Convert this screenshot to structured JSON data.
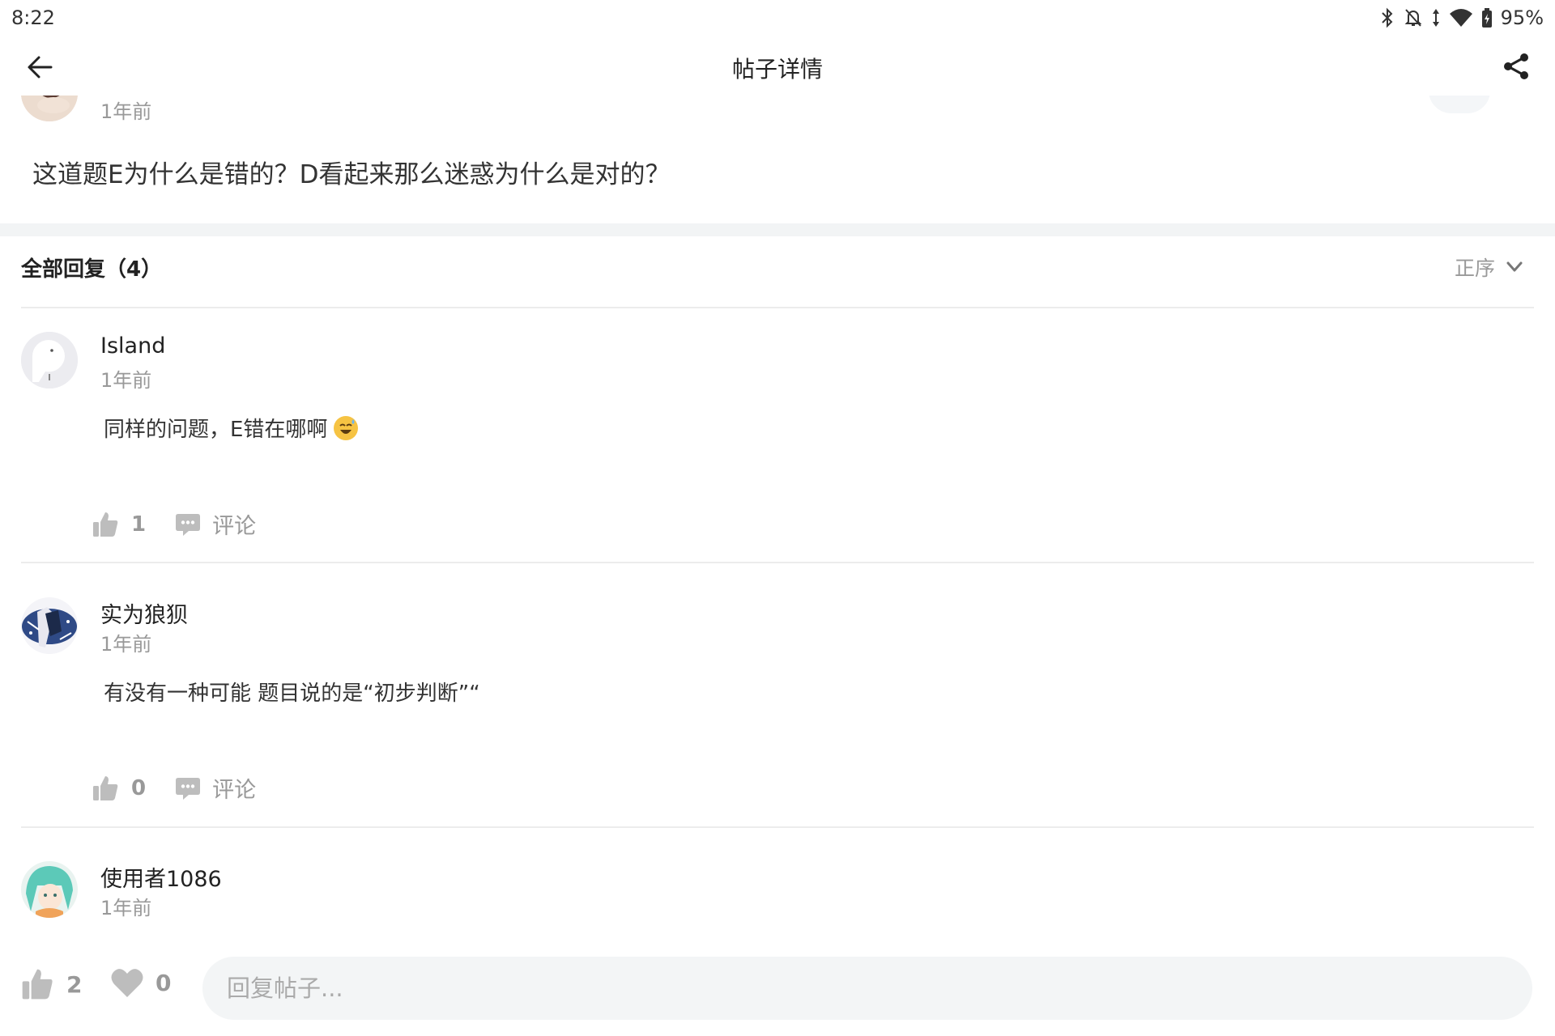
{
  "status_bar": {
    "time": "8:22",
    "battery": "95%",
    "icons": [
      "bluetooth-icon",
      "bell-off-icon",
      "data-arrows-icon",
      "wifi-icon",
      "battery-icon"
    ]
  },
  "app_bar": {
    "title": "帖子详情",
    "back_icon": "arrow-left-icon",
    "share_icon": "share-icon"
  },
  "post": {
    "time": "1年前",
    "body": "这道题E为什么是错的？D看起来那么迷惑为什么是对的？"
  },
  "replies_header": {
    "title": "全部回复（4）",
    "sort_label": "正序"
  },
  "replies": [
    {
      "name": "Island",
      "time": "1年前",
      "body": "同样的问题，E错在哪啊",
      "emoji": "sweat-smile-emoji",
      "likes": "1",
      "comment_label": "评论"
    },
    {
      "name": "实为狼狈",
      "time": "1年前",
      "body": "有没有一种可能  题目说的是“初步判断”“",
      "likes": "0",
      "comment_label": "评论"
    },
    {
      "name": "使用者1086",
      "time": "1年前"
    }
  ],
  "bottom_bar": {
    "like_count": "2",
    "favorite_count": "0",
    "reply_placeholder": "回复帖子..."
  },
  "colors": {
    "accent_blue": "#3a8ff0",
    "muted_text": "#999999",
    "divider": "#f2f4f5",
    "input_bg": "#f3f5f6"
  }
}
